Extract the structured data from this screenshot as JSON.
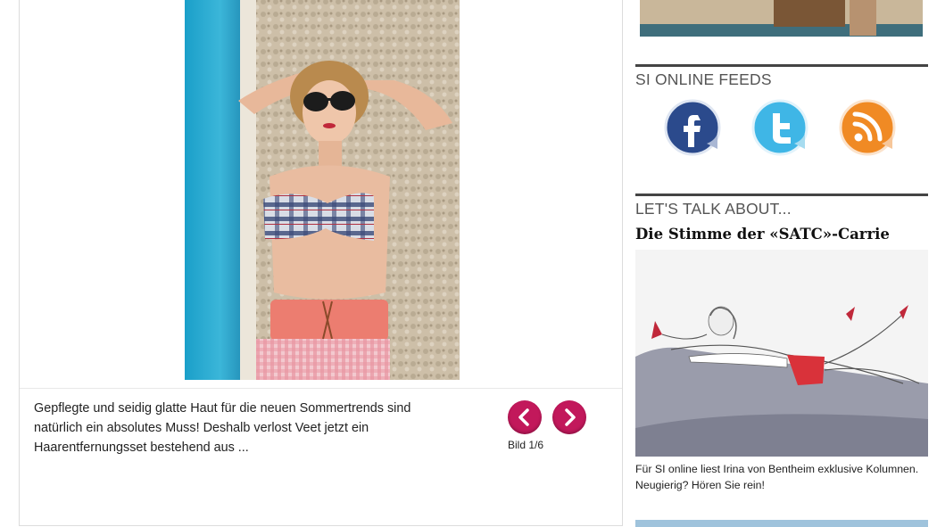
{
  "gallery": {
    "caption": "Gepflegte und seidig glatte Haut für die neuen Sommertrends sind natürlich ein absolutes Muss! Deshalb verlost Veet jetzt ein Haarentfernungsset bestehend aus ...",
    "counter": "Bild 1/6",
    "prev_icon": "chevron-left-icon",
    "next_icon": "chevron-right-icon",
    "accent_color": "#c2185b"
  },
  "sidebar": {
    "feeds": {
      "title": "SI ONLINE FEEDS",
      "items": [
        {
          "icon": "facebook-icon",
          "color": "#2b4a8c"
        },
        {
          "icon": "twitter-icon",
          "color": "#3fb6e6"
        },
        {
          "icon": "rss-icon",
          "color": "#f08a24"
        }
      ]
    },
    "talk": {
      "title": "LET'S TALK ABOUT...",
      "headline": "Die Stimme der «SATC»-Carrie",
      "text": "Für SI online liest Irina von Bentheim exklusive Kolumnen. Neugierig? Hören Sie rein!"
    }
  }
}
